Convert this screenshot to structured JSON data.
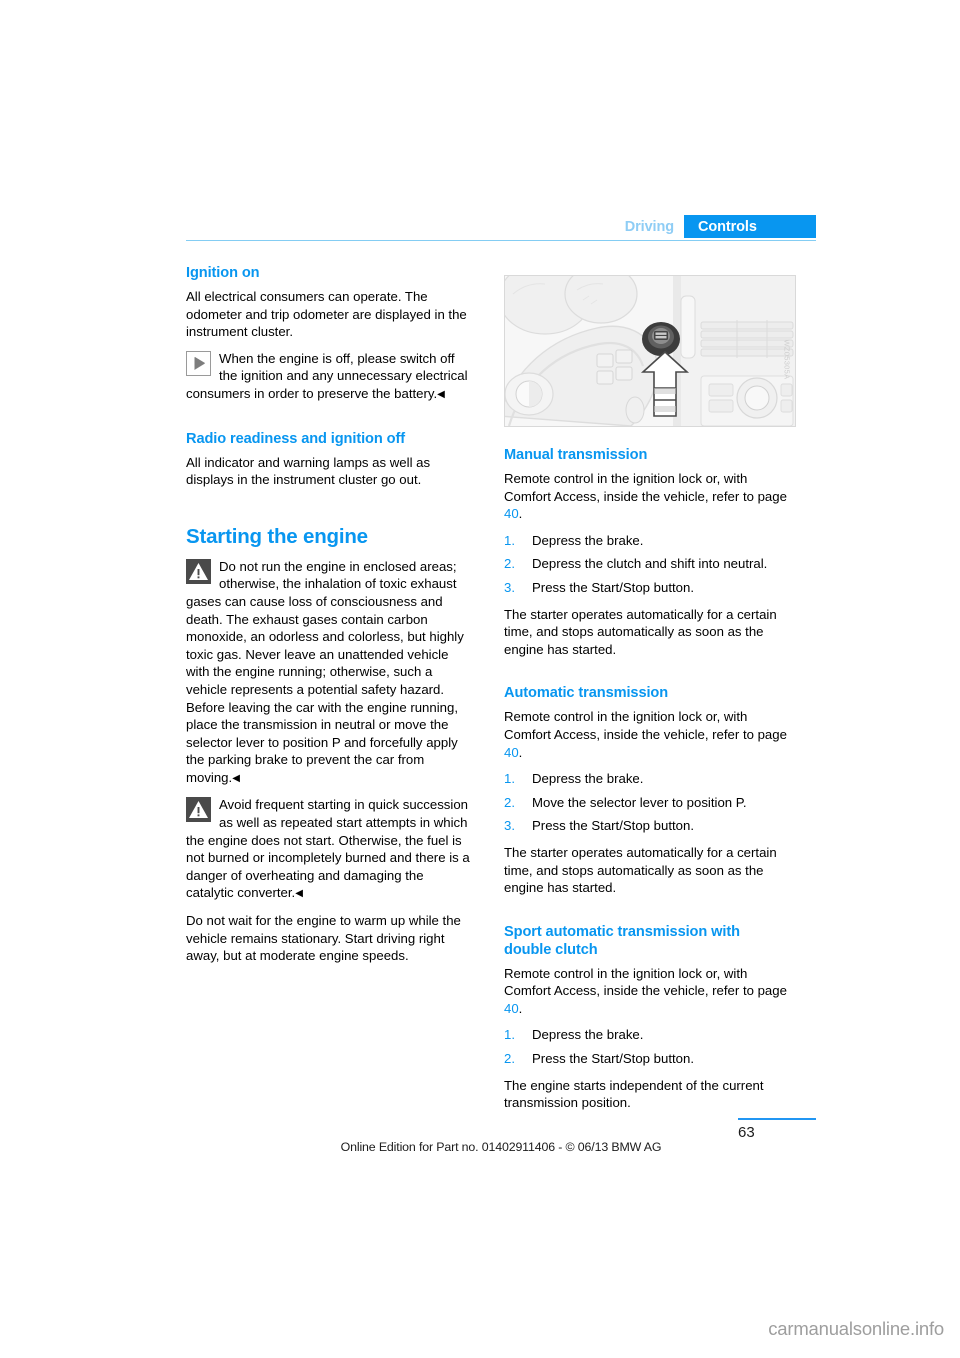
{
  "header": {
    "tab_driving": "Driving",
    "tab_controls": "Controls",
    "accent_color": "#0896f0",
    "muted_accent_color": "#8fcdf5"
  },
  "left_column": {
    "section_ignition_on": {
      "heading": "Ignition on",
      "paragraph": "All electrical consumers can operate. The odometer and trip odometer are displayed in the instrument cluster.",
      "note_icon": "note-triangle-icon",
      "note_text": "When the engine is off, please switch off the ignition and any unnecessary electrical consumers in order to preserve the battery.",
      "note_endmark": "◀"
    },
    "section_radio_readiness": {
      "heading": "Radio readiness and ignition off",
      "paragraph": "All indicator and warning lamps as well as displays in the instrument cluster go out."
    },
    "section_starting_engine": {
      "heading": "Starting the engine",
      "warning_icon": "warning-triangle-icon",
      "warning_1": "Do not run the engine in enclosed areas; otherwise, the inhalation of toxic exhaust gases can cause loss of consciousness and death. The exhaust gases contain carbon monoxide, an odorless and colorless, but highly toxic gas. Never leave an unattended vehicle with the engine running; otherwise, such a vehicle represents a potential safety hazard. Before leaving the car with the engine running, place the transmission in neutral or move the selector lever to position P and forcefully apply the parking brake to prevent the car from moving.",
      "warning_1_endmark": "◀",
      "warning_2": "Avoid frequent starting in quick succession as well as repeated start attempts in which the engine does not start. Otherwise, the fuel is not burned or incompletely burned and there is a danger of overheating and damaging the catalytic converter.",
      "warning_2_endmark": "◀",
      "closing_paragraph": "Do not wait for the engine to warm up while the vehicle remains stationary. Start driving right away, but at moderate engine speeds."
    }
  },
  "figure": {
    "name": "ignition-lock-dashboard-illustration",
    "code_label": "WZ05305A",
    "alt": "BMW steering wheel and dashboard with arrow pointing to the ignition lock / Start-Stop button"
  },
  "right_column": {
    "section_manual": {
      "heading": "Manual transmission",
      "intro_prefix": "Remote control in the ignition lock or, with Comfort Access, inside the vehicle, refer to page ",
      "intro_page_ref": "40",
      "intro_suffix": ".",
      "steps": [
        {
          "num": "1.",
          "text": "Depress the brake."
        },
        {
          "num": "2.",
          "text": "Depress the clutch and shift into neutral."
        },
        {
          "num": "3.",
          "text": "Press the Start/Stop button."
        }
      ],
      "closing": "The starter operates automatically for a certain time, and stops automatically as soon as the engine has started."
    },
    "section_automatic": {
      "heading": "Automatic transmission",
      "intro_prefix": "Remote control in the ignition lock or, with Comfort Access, inside the vehicle, refer to page ",
      "intro_page_ref": "40",
      "intro_suffix": ".",
      "steps": [
        {
          "num": "1.",
          "text": "Depress the brake."
        },
        {
          "num": "2.",
          "text": "Move the selector lever to position P."
        },
        {
          "num": "3.",
          "text": "Press the Start/Stop button."
        }
      ],
      "closing": "The starter operates automatically for a certain time, and stops automatically as soon as the engine has started."
    },
    "section_sport_automatic": {
      "heading_line1": "Sport automatic transmission with",
      "heading_line2": "double clutch",
      "intro_prefix": "Remote control in the ignition lock or, with Comfort Access, inside the vehicle, refer to page ",
      "intro_page_ref": "40",
      "intro_suffix": ".",
      "steps": [
        {
          "num": "1.",
          "text": "Depress the brake."
        },
        {
          "num": "2.",
          "text": "Press the Start/Stop button."
        }
      ],
      "closing": "The engine starts independent of the current transmission position."
    }
  },
  "footer": {
    "page_number": "63",
    "edition_line": "Online Edition for Part no. 01402911406 - © 06/13 BMW AG",
    "watermark": "carmanualsonline.info"
  }
}
